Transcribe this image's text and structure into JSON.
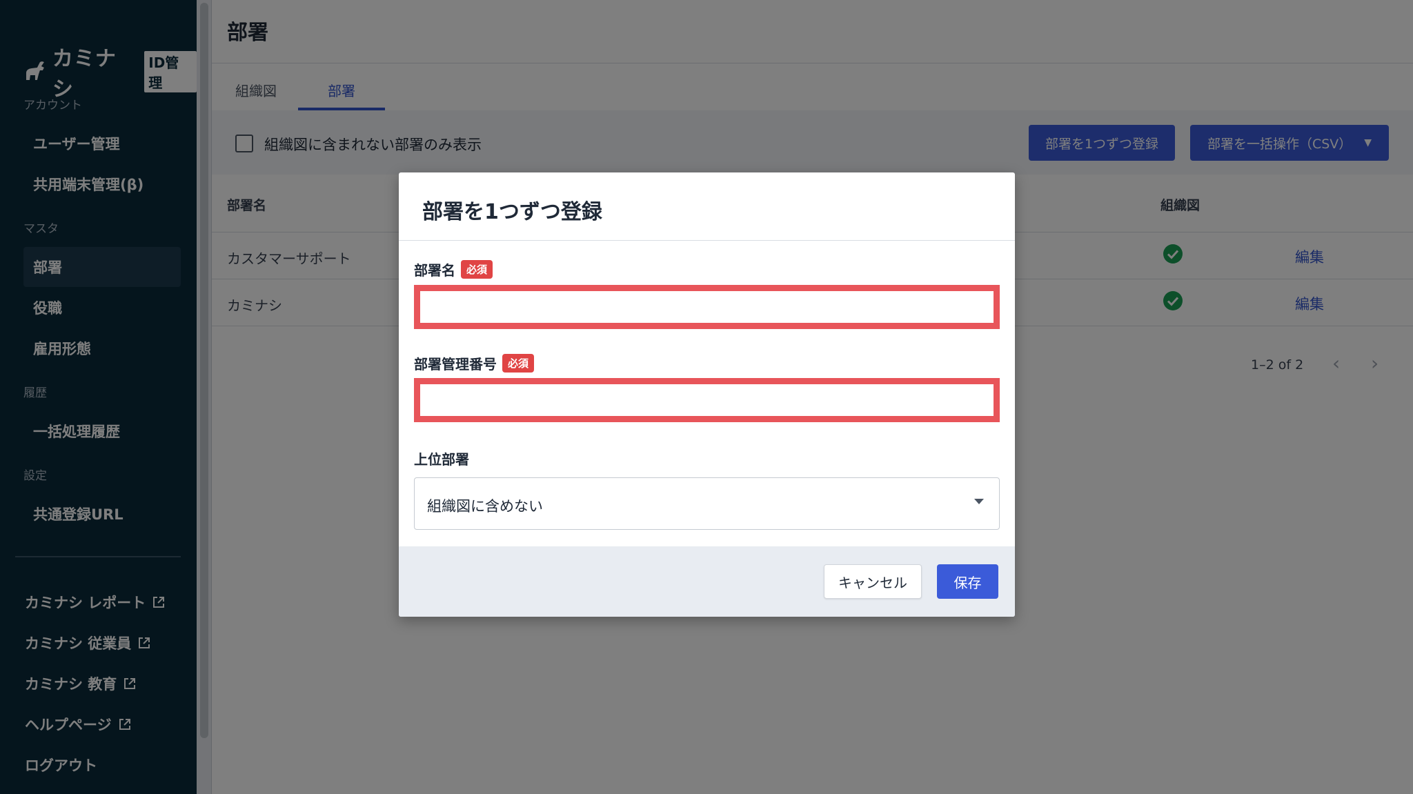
{
  "app": {
    "logo_text": "カミナシ",
    "logo_badge": "ID管理"
  },
  "sidebar": {
    "sections": [
      {
        "label": "アカウント",
        "items": [
          "ユーザー管理",
          "共用端末管理(β)"
        ]
      },
      {
        "label": "マスタ",
        "items": [
          "部署",
          "役職",
          "雇用形態"
        ]
      },
      {
        "label": "履歴",
        "items": [
          "一括処理履歴"
        ]
      },
      {
        "label": "設定",
        "items": [
          "共通登録URL"
        ]
      }
    ],
    "active_item": "部署",
    "external_links": [
      "カミナシ レポート",
      "カミナシ 従業員",
      "カミナシ 教育",
      "ヘルプページ"
    ],
    "logout_label": "ログアウト"
  },
  "page": {
    "title": "部署",
    "tabs": [
      "組織図",
      "部署"
    ],
    "active_tab": "部署"
  },
  "toolbar": {
    "filter_checkbox_label": "組織図に含まれない部署のみ表示",
    "filter_checked": false,
    "register_one_label": "部署を1つずつ登録",
    "bulk_label": "部署を一括操作（CSV）"
  },
  "table": {
    "columns": [
      "部署名",
      "組織図"
    ],
    "rows": [
      {
        "name": "カスタマーサポート",
        "in_org_chart": true,
        "action": "編集"
      },
      {
        "name": "カミナシ",
        "in_org_chart": true,
        "action": "編集"
      }
    ],
    "pagination": "1–2 of 2"
  },
  "modal": {
    "title": "部署を1つずつ登録",
    "fields": {
      "name_label": "部署名",
      "name_value": "",
      "code_label": "部署管理番号",
      "code_value": "",
      "required_badge": "必須",
      "parent_label": "上位部署",
      "parent_value": "組織図に含めない"
    },
    "cancel_label": "キャンセル",
    "save_label": "保存"
  },
  "colors": {
    "sidebar_bg": "#0b2a3b",
    "primary": "#3b5bd9",
    "error_border": "#e8555a",
    "required_badge": "#e04444",
    "check_green": "#1a9e55"
  }
}
